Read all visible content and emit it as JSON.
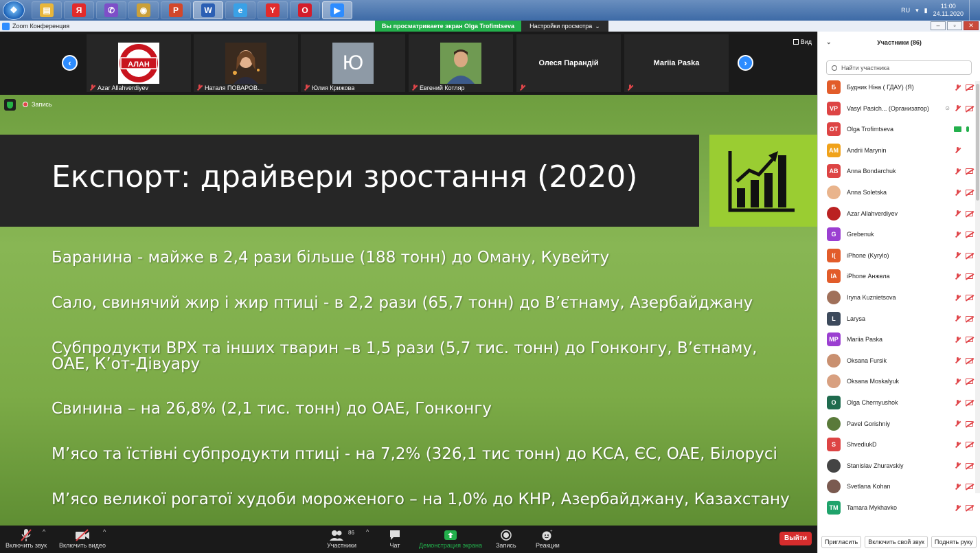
{
  "taskbar": {
    "apps": [
      {
        "name": "file-explorer-app",
        "glyph": "▤",
        "color": "#e8b63a"
      },
      {
        "name": "yandex-app",
        "glyph": "Я",
        "color": "#e22b2b"
      },
      {
        "name": "viber-app",
        "glyph": "✆",
        "color": "#7d4fc8"
      },
      {
        "name": "media-app",
        "glyph": "◉",
        "color": "#caa03a"
      },
      {
        "name": "powerpoint-app",
        "glyph": "P",
        "color": "#d2472b"
      },
      {
        "name": "word-app",
        "glyph": "W",
        "color": "#2b5fb4",
        "active": true
      },
      {
        "name": "ie-app",
        "glyph": "e",
        "color": "#3aa1e6"
      },
      {
        "name": "yandex-browser-app",
        "glyph": "Y",
        "color": "#e22b2b"
      },
      {
        "name": "opera-app",
        "glyph": "O",
        "color": "#d41c2b"
      },
      {
        "name": "zoom-app",
        "glyph": "▶",
        "color": "#2d8cff",
        "active": true
      }
    ],
    "lang": "RU",
    "time": "11:00",
    "date": "24.11.2020"
  },
  "titlebar": {
    "app_title": "Zoom Конференция",
    "share_banner": "Вы просматриваете экран Olga Trofimtseva",
    "view_options": "Настройки просмотра"
  },
  "thumbs": {
    "view_label": "Вид",
    "items": [
      {
        "label": "Azar Allahverdiyev",
        "type": "logo",
        "logo_text": "АЛАН"
      },
      {
        "label": "Наталя ПОВАРОВ...",
        "type": "photo"
      },
      {
        "label": "Юлия Крижова",
        "type": "letter",
        "letter": "Ю"
      },
      {
        "label": "Евгений Котляр",
        "type": "photo2"
      },
      {
        "label": "",
        "type": "name",
        "big_name": "Олеся Парандій"
      },
      {
        "label": "",
        "type": "name",
        "big_name": "Mariia Paska"
      }
    ]
  },
  "slide": {
    "recording_label": "Запись",
    "title": "Експорт: драйвери зростання (2020)",
    "bullets": [
      "Баранина - майже в 2,4 рази більше (188 тонн) до Оману, Кувейту",
      "Сало, свинячий жир і жир птиці - в 2,2 рази (65,7 тонн) до В’єтнаму, Азербайджану",
      "Субпродукти ВРХ та інших тварин –в 1,5 рази (5,7 тис. тонн) до Гонконгу, В’єтнаму, ОАЕ, К’от-Дівуару",
      "Свинина – на 26,8% (2,1 тис. тонн) до ОАЕ, Гонконгу",
      "М’ясо та їстівні субпродукти птиці - на 7,2% (326,1 тис тонн)  до КСА, ЄС, ОАЕ, Білорусі",
      "М’ясо великої рогатої худоби мороженого – на 1,0% до КНР, Азербайджану, Казахстану"
    ]
  },
  "toolbar": {
    "audio": "Включить звук",
    "video": "Включить видео",
    "participants": "Участники",
    "participants_count": "86",
    "chat": "Чат",
    "share": "Демонстрация экрана",
    "record": "Запись",
    "reactions": "Реакции",
    "leave": "Выйти"
  },
  "panel": {
    "title": "Участники (86)",
    "search_placeholder": "Найти участника",
    "participants": [
      {
        "initials": "Б",
        "color": "#e25c2a",
        "name": "Будник Ніна ( ГДАУ) (Я)",
        "video": true
      },
      {
        "initials": "VP",
        "color": "#d44",
        "name": "Vasyl Pasich... (Организатор)",
        "video": true,
        "host": true
      },
      {
        "initials": "OT",
        "color": "#d44",
        "name": "Olga Trofimtseva",
        "share": true,
        "mic_on": true
      },
      {
        "initials": "AM",
        "color": "#f0a21a",
        "name": "Andrii Marynin",
        "video": false
      },
      {
        "initials": "AB",
        "color": "#d44",
        "name": "Anna Bondarchuk",
        "video": true
      },
      {
        "initials": "",
        "color": "#e9b48c",
        "name": "Anna Soletska",
        "video": true,
        "photo": true
      },
      {
        "initials": "",
        "color": "#b22",
        "name": "Azar Allahverdiyev",
        "video": true,
        "photo": true
      },
      {
        "initials": "G",
        "color": "#9b3fd1",
        "name": "Grebenuk",
        "video": true
      },
      {
        "initials": "I(",
        "color": "#e25c2a",
        "name": "iPhone (Kyrylo)",
        "video": true
      },
      {
        "initials": "IA",
        "color": "#e25c2a",
        "name": "iPhone Анжела",
        "video": true
      },
      {
        "initials": "",
        "color": "#a0705a",
        "name": "Iryna Kuznietsova",
        "video": true,
        "photo": true
      },
      {
        "initials": "L",
        "color": "#3d4a5c",
        "name": "Larysa",
        "video": true
      },
      {
        "initials": "MP",
        "color": "#9b3fd1",
        "name": "Mariia Paska",
        "video": true
      },
      {
        "initials": "",
        "color": "#c99070",
        "name": "Oksana Fursik",
        "video": true,
        "photo": true
      },
      {
        "initials": "",
        "color": "#d8a080",
        "name": "Oksana Moskalyuk",
        "video": true,
        "photo": true
      },
      {
        "initials": "O",
        "color": "#1f6b4e",
        "name": "Olga Chernyushok",
        "video": true
      },
      {
        "initials": "",
        "color": "#5a7a3a",
        "name": "Pavel Gorishniy",
        "video": true,
        "photo": true
      },
      {
        "initials": "S",
        "color": "#d44",
        "name": "ShvediukD",
        "video": true
      },
      {
        "initials": "",
        "color": "#444",
        "name": "Stanislav Zhuravskiy",
        "video": true,
        "photo": true
      },
      {
        "initials": "",
        "color": "#7a5a50",
        "name": "Svetlana Kohan",
        "video": true,
        "photo": true
      },
      {
        "initials": "TM",
        "color": "#1fa36b",
        "name": "Tamara Mykhavko",
        "video": true
      }
    ],
    "invite": "Пригласить",
    "unmute_me": "Включить свой звук",
    "raise_hand": "Поднять руку"
  }
}
